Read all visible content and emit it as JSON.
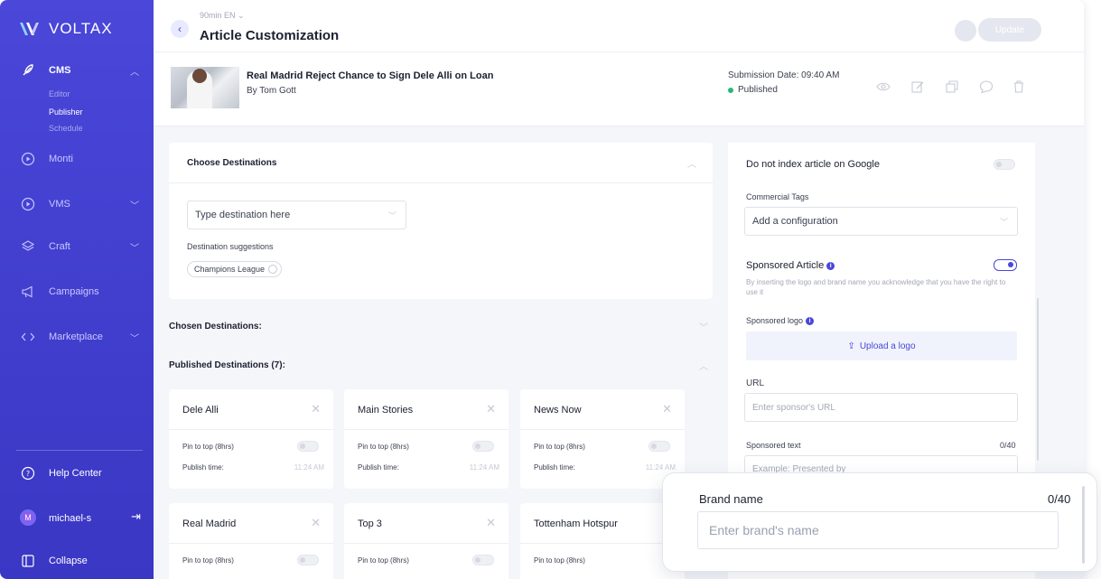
{
  "brand": {
    "name": "VOLTAX",
    "accent": "#4a47d9"
  },
  "sidebar": {
    "cms": {
      "label": "CMS",
      "icon": "feather-icon",
      "sub": [
        "Editor",
        "Publisher",
        "Schedule"
      ]
    },
    "items": [
      {
        "label": "Monti",
        "icon": "play-circle-icon"
      },
      {
        "label": "VMS",
        "icon": "play-circle-icon"
      },
      {
        "label": "Craft",
        "icon": "layers-icon"
      },
      {
        "label": "Campaigns",
        "icon": "megaphone-icon"
      },
      {
        "label": "Marketplace",
        "icon": "code-icon"
      }
    ],
    "help": "Help Center",
    "user": {
      "initial": "M",
      "name": "michael-s"
    },
    "collapse": "Collapse"
  },
  "header": {
    "site_selector": "90min EN",
    "title": "Article Customization",
    "update_label": "Update"
  },
  "article": {
    "title": "Real Madrid Reject Chance to Sign Dele Alli on Loan",
    "author": "By Tom Gott",
    "submission": "Submission Date: 09:40 AM",
    "status": "Published",
    "status_color": "#2bb673"
  },
  "destinations": {
    "section_title": "Choose Destinations",
    "input_placeholder": "Type destination here",
    "suggestions_label": "Destination suggestions",
    "suggestions": [
      "Champions League"
    ],
    "chosen_title": "Chosen Destinations:",
    "published_title": "Published Destinations (7):",
    "pin_label": "Pin to top (8hrs)",
    "publish_time_label": "Publish time:",
    "cards": [
      {
        "name": "Dele Alli",
        "time": "11:24 AM"
      },
      {
        "name": "Main Stories",
        "time": "11:24 AM"
      },
      {
        "name": "News Now",
        "time": "11:24 AM"
      },
      {
        "name": "Real Madrid",
        "time": ""
      },
      {
        "name": "Top 3",
        "time": ""
      },
      {
        "name": "Tottenham Hotspur",
        "time": ""
      }
    ]
  },
  "settings": {
    "no_index": "Do not index article on Google",
    "commercial_tags": "Commercial Tags",
    "commercial_placeholder": "Add a configuration",
    "sponsored": "Sponsored Article",
    "sponsored_note": "By inserting the logo and brand name you acknowledge that you have the right to use it",
    "sponsored_logo": "Sponsored logo",
    "upload": "Upload a logo",
    "url_label": "URL",
    "url_placeholder": "Enter sponsor's URL",
    "sponsored_text": "Sponsored text",
    "sponsored_text_count": "0/40",
    "sponsored_text_placeholder": "Example: Presented by"
  },
  "brand_field": {
    "label": "Brand name",
    "count": "0/40",
    "placeholder": "Enter brand's name"
  }
}
